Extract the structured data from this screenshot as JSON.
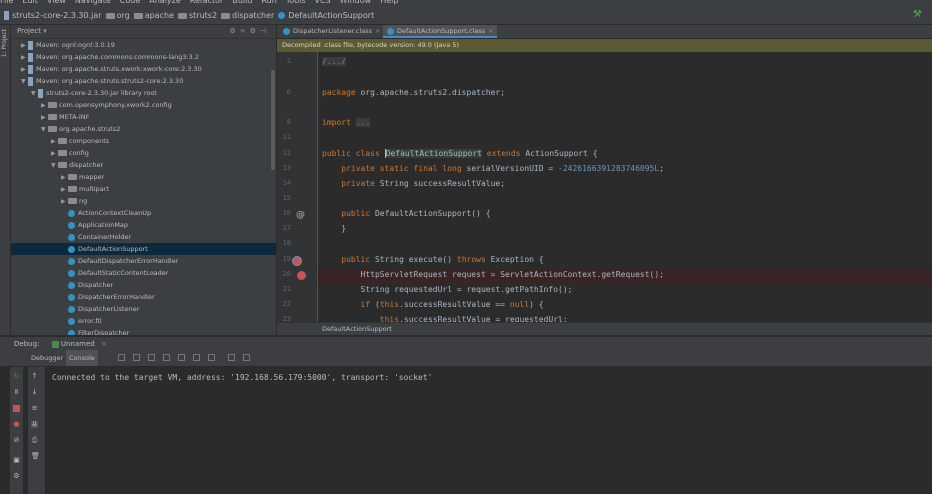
{
  "menu": [
    "File",
    "Edit",
    "View",
    "Navigate",
    "Code",
    "Analyze",
    "Refactor",
    "Build",
    "Run",
    "Tools",
    "VCS",
    "Window",
    "Help"
  ],
  "breadcrumbs": [
    "struts2-core-2.3.30.jar",
    "org",
    "apache",
    "struts2",
    "dispatcher",
    "DefaultActionSupport"
  ],
  "left_strip": {
    "project_label": "1: Project",
    "favorites_label": "2: Favorites",
    "web_label": "Web"
  },
  "project_panel": {
    "title": "Project"
  },
  "tree": [
    {
      "label": "Maven: ognl:ognl:3.0.19",
      "indent": 0,
      "arrow": "▶",
      "icon": "jar"
    },
    {
      "label": "Maven: org.apache.commons:commons-lang3:3.2",
      "indent": 0,
      "arrow": "▶",
      "icon": "jar"
    },
    {
      "label": "Maven: org.apache.struts.xwork:xwork-core:2.3.30",
      "indent": 0,
      "arrow": "▶",
      "icon": "jar"
    },
    {
      "label": "Maven: org.apache.struts:struts2-core:2.3.30",
      "indent": 0,
      "arrow": "▼",
      "icon": "jar"
    },
    {
      "label": "struts2-core-2.3.30.jar  library root",
      "indent": 1,
      "arrow": "▼",
      "icon": "jar"
    },
    {
      "label": "com.opensymphony.xwork2.config",
      "indent": 2,
      "arrow": "▶",
      "icon": "folder"
    },
    {
      "label": "META-INF",
      "indent": 2,
      "arrow": "▶",
      "icon": "folder"
    },
    {
      "label": "org.apache.struts2",
      "indent": 2,
      "arrow": "▼",
      "icon": "folder"
    },
    {
      "label": "components",
      "indent": 3,
      "arrow": "▶",
      "icon": "folder"
    },
    {
      "label": "config",
      "indent": 3,
      "arrow": "▶",
      "icon": "folder"
    },
    {
      "label": "dispatcher",
      "indent": 3,
      "arrow": "▼",
      "icon": "folder"
    },
    {
      "label": "mapper",
      "indent": 4,
      "arrow": "▶",
      "icon": "folder"
    },
    {
      "label": "multipart",
      "indent": 4,
      "arrow": "▶",
      "icon": "folder"
    },
    {
      "label": "ng",
      "indent": 4,
      "arrow": "▶",
      "icon": "folder"
    },
    {
      "label": "ActionContextCleanUp",
      "indent": 4,
      "arrow": "",
      "icon": "class"
    },
    {
      "label": "ApplicationMap",
      "indent": 4,
      "arrow": "",
      "icon": "class"
    },
    {
      "label": "ContainerHolder",
      "indent": 4,
      "arrow": "",
      "icon": "class"
    },
    {
      "label": "DefaultActionSupport",
      "indent": 4,
      "arrow": "",
      "icon": "class",
      "selected": true
    },
    {
      "label": "DefaultDispatcherErrorHandler",
      "indent": 4,
      "arrow": "",
      "icon": "class"
    },
    {
      "label": "DefaultStaticContentLoader",
      "indent": 4,
      "arrow": "",
      "icon": "class"
    },
    {
      "label": "Dispatcher",
      "indent": 4,
      "arrow": "",
      "icon": "class"
    },
    {
      "label": "DispatcherErrorHandler",
      "indent": 4,
      "arrow": "",
      "icon": "class"
    },
    {
      "label": "DispatcherListener",
      "indent": 4,
      "arrow": "",
      "icon": "class"
    },
    {
      "label": "error.ftl",
      "indent": 4,
      "arrow": "",
      "icon": "class"
    },
    {
      "label": "FilterDispatcher",
      "indent": 4,
      "arrow": "",
      "icon": "class"
    }
  ],
  "editor_tabs": [
    {
      "label": "DispatcherListener.class",
      "active": false
    },
    {
      "label": "DefaultActionSupport.class",
      "active": true
    }
  ],
  "banner": "Decompiled .class file, bytecode version: 49.0 (Java 5)",
  "line_numbers": [
    "1",
    "",
    "6",
    "",
    "8",
    "11",
    "12",
    "13",
    "14",
    "15",
    "16",
    "17",
    "18",
    "19",
    "20",
    "21",
    "22",
    "23"
  ],
  "code": [
    {
      "ln": "1",
      "html": "<span class=\"fold\">/.../</span>"
    },
    {
      "ln": "6",
      "html": "<span class=\"kw\">package</span> org.apache.struts2.dispatcher;"
    },
    {
      "ln": "8",
      "html": "<span class=\"kw\">import</span> <span class=\"fold\">...</span>"
    },
    {
      "ln": "12",
      "html": "<span class=\"kw\">public class</span> <span class=\"caret\"></span><span class=\"hl-name\">DefaultActionSupport</span> <span class=\"kw\">extends</span> ActionSupport {"
    },
    {
      "ln": "13",
      "html": "    <span class=\"kw\">private static final long</span> serialVersionUID = <span class=\"num\">-2426166391283746095L</span>;"
    },
    {
      "ln": "14",
      "html": "    <span class=\"kw\">private</span> String successResultValue;"
    },
    {
      "ln": "16",
      "html": "    <span class=\"kw\">public</span> DefaultActionSupport() {"
    },
    {
      "ln": "17",
      "html": "    }"
    },
    {
      "ln": "19",
      "html": "    <span class=\"kw\">public</span> String execute() <span class=\"kw\">throws</span> Exception {"
    },
    {
      "ln": "20",
      "html": "        HttpServletRequest request = ServletActionContext.getRequest();"
    },
    {
      "ln": "21",
      "html": "        String requestedUrl = request.getPathInfo();"
    },
    {
      "ln": "22",
      "html": "        <span class=\"kw\">if</span> (<span class=\"kw\">this</span>.successResultValue == <span class=\"kw\">null</span>) {"
    },
    {
      "ln": "23",
      "html": "            <span class=\"kw\">this</span>.successResultValue = requestedUrl;"
    }
  ],
  "status_crumb": "DefaultActionSupport",
  "debug": {
    "title": "Debug:",
    "session": "Unnamed",
    "tabs": [
      "Debugger",
      "Console"
    ],
    "console_output": "Connected to the target VM, address: '192.168.56.179:5000', transport: 'socket'"
  }
}
